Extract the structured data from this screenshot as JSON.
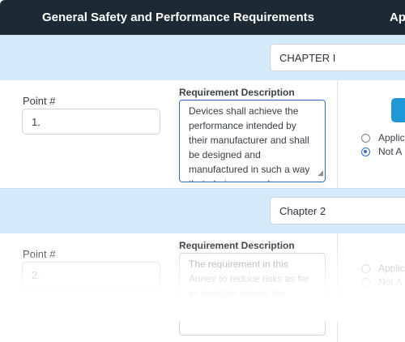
{
  "header": {
    "col_requirements": "General Safety and Performance Requirements",
    "col_applicability": "Ap"
  },
  "sections": [
    {
      "chapter": "CHAPTER I",
      "point_label": "Point #",
      "point_value": "1.",
      "requirement_label": "Requirement Description",
      "requirement_text": "Devices shall achieve the performance intended by their manufacturer and shall be designed and manufactured in such a way that, during normal",
      "radio_applicable": "Applic",
      "radio_not_applicable": "Not A",
      "selected": "not_applicable"
    },
    {
      "chapter": "Chapter 2",
      "point_label": "Point #",
      "point_placeholder": "2.",
      "requirement_label": "Requirement Description",
      "requirement_text": "The requirement in this Annex to reduce risks as far as possible means the reduction of risks as far",
      "radio_applicable": "Applic",
      "radio_not_applicable": "Not A"
    }
  ],
  "colors": {
    "header_bg": "#1e2a33",
    "chapter_band": "#d4ecf9",
    "accent": "#2f6bd6",
    "button": "#1f98d6"
  }
}
